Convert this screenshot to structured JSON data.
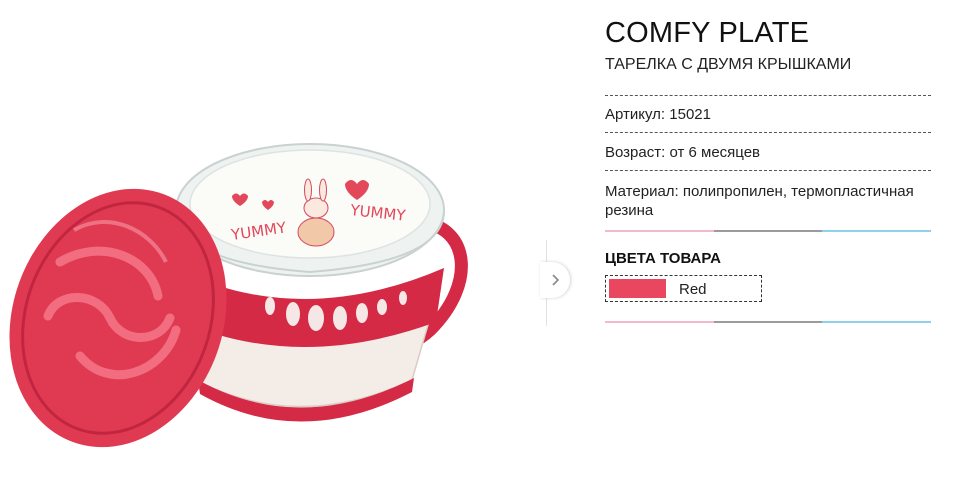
{
  "product": {
    "title": "COMFY PLATE",
    "subtitle": "ТАРЕЛКА С ДВУМЯ КРЫШКАМИ",
    "specs": [
      {
        "text": "Артикул: 15021"
      },
      {
        "text": "Возраст: от 6 месяцев"
      },
      {
        "text": "Материал: полипропилен, термопластичная резина"
      }
    ]
  },
  "image_text": "YUMMY",
  "colors": {
    "heading": "ЦВЕТА ТОВАРА",
    "options": [
      {
        "label": "Red",
        "hex": "#e8475f"
      }
    ],
    "stripe": [
      "#f2b8cc",
      "#9b9b9b",
      "#8fd0ea"
    ]
  },
  "gallery": {
    "next_icon": "chevron-right-icon"
  }
}
